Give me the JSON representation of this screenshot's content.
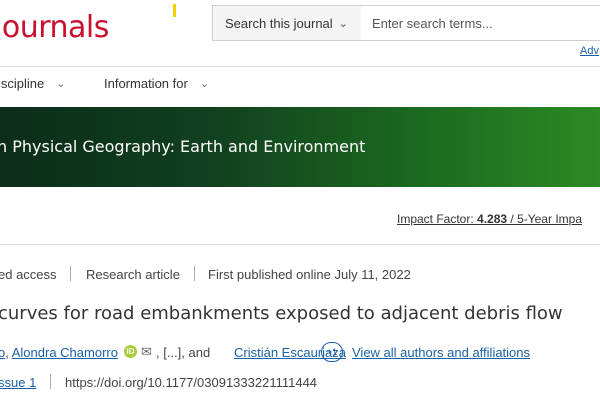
{
  "header": {
    "brand": "journals",
    "search_scope": "Search this journal",
    "search_placeholder": "Enter search terms...",
    "advanced_link": "Adv"
  },
  "nav": {
    "items": [
      {
        "label": "iscipline"
      },
      {
        "label": "Information for"
      }
    ]
  },
  "banner": {
    "journal_title": "n Physical Geography: Earth and Environment"
  },
  "impact": {
    "label": "Impact Factor: ",
    "value": "4.283",
    "five_year": " / 5-Year Impa"
  },
  "article_meta": {
    "access": "ed access",
    "type": "Research article",
    "published": "First published online July 11, 2022"
  },
  "article": {
    "title": "curves for road embankments exposed to adjacent debris flow",
    "author_partial": "o",
    "author_sep1": ", ",
    "author_2": "Alondra Chamorro",
    "orcid_label": "iD",
    "author_ellipsis": ", [...], and ",
    "author_3": "Cristián Escauriaza",
    "more_count": "+1",
    "view_all": "View all authors and affiliations",
    "issue": "ssue 1",
    "doi": "https://doi.org/10.1177/03091333221111444"
  },
  "colors": {
    "brand": "#c8102e",
    "link": "#1a5fa8",
    "banner_dark": "#0c2d1a",
    "banner_light": "#2b8a24"
  }
}
